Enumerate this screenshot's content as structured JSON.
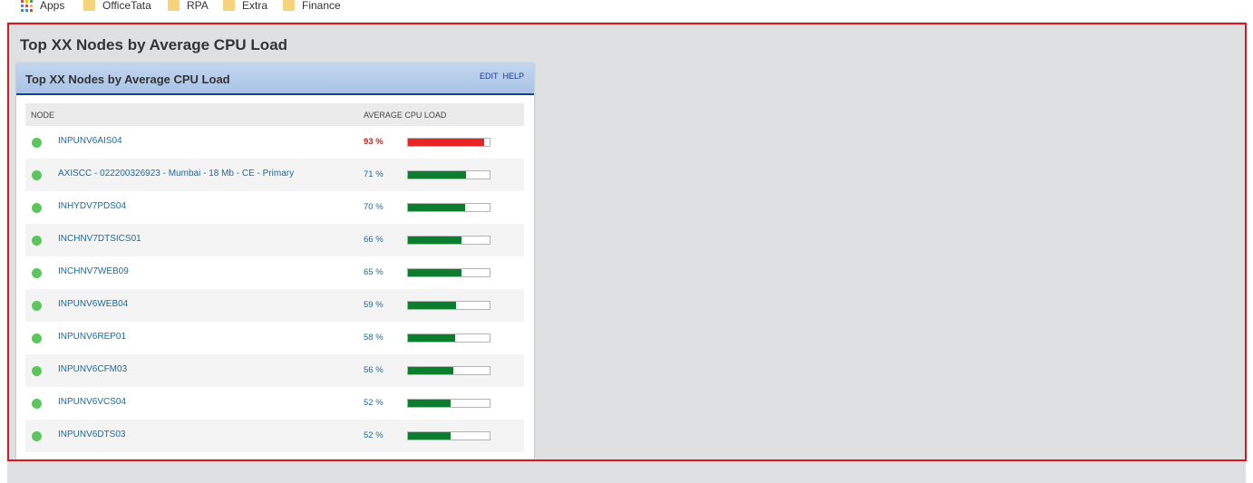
{
  "bookmarks": [
    {
      "label": "Apps",
      "icon": "apps-grid-icon"
    },
    {
      "label": "OfficeTata",
      "icon": "folder-icon"
    },
    {
      "label": "RPA",
      "icon": "folder-icon"
    },
    {
      "label": "Extra",
      "icon": "folder-icon"
    },
    {
      "label": "Finance",
      "icon": "folder-icon"
    }
  ],
  "page": {
    "title": "Top XX Nodes by Average CPU Load"
  },
  "widget": {
    "title": "Top XX Nodes by Average CPU Load",
    "edit_label": "EDIT",
    "help_label": "HELP",
    "columns": {
      "node": "NODE",
      "cpu": "AVERAGE CPU LOAD"
    },
    "rows": [
      {
        "node": "INPUNV6AIS04",
        "pct_label": "93 %",
        "value": 93,
        "status": "critical"
      },
      {
        "node": "AXISCC - 022200326923 - Mumbai - 18 Mb - CE - Primary",
        "pct_label": "71 %",
        "value": 71,
        "status": "normal"
      },
      {
        "node": "INHYDV7PDS04",
        "pct_label": "70 %",
        "value": 70,
        "status": "normal"
      },
      {
        "node": "INCHNV7DTSICS01",
        "pct_label": "66 %",
        "value": 66,
        "status": "normal"
      },
      {
        "node": "INCHNV7WEB09",
        "pct_label": "65 %",
        "value": 65,
        "status": "normal"
      },
      {
        "node": "INPUNV6WEB04",
        "pct_label": "59 %",
        "value": 59,
        "status": "normal"
      },
      {
        "node": "INPUNV6REP01",
        "pct_label": "58 %",
        "value": 58,
        "status": "normal"
      },
      {
        "node": "INPUNV6CFM03",
        "pct_label": "56 %",
        "value": 56,
        "status": "normal"
      },
      {
        "node": "INPUNV6VCS04",
        "pct_label": "52 %",
        "value": 52,
        "status": "normal"
      },
      {
        "node": "INPUNV6DTS03",
        "pct_label": "52 %",
        "value": 52,
        "status": "normal"
      }
    ]
  },
  "colors": {
    "status_up": "#5cc55c",
    "bar_normal": "#0b7d2e",
    "bar_critical": "#e82424",
    "critical_text": "#d31a1a",
    "link": "#1a6a9a",
    "highlight_border": "#e0151c"
  }
}
